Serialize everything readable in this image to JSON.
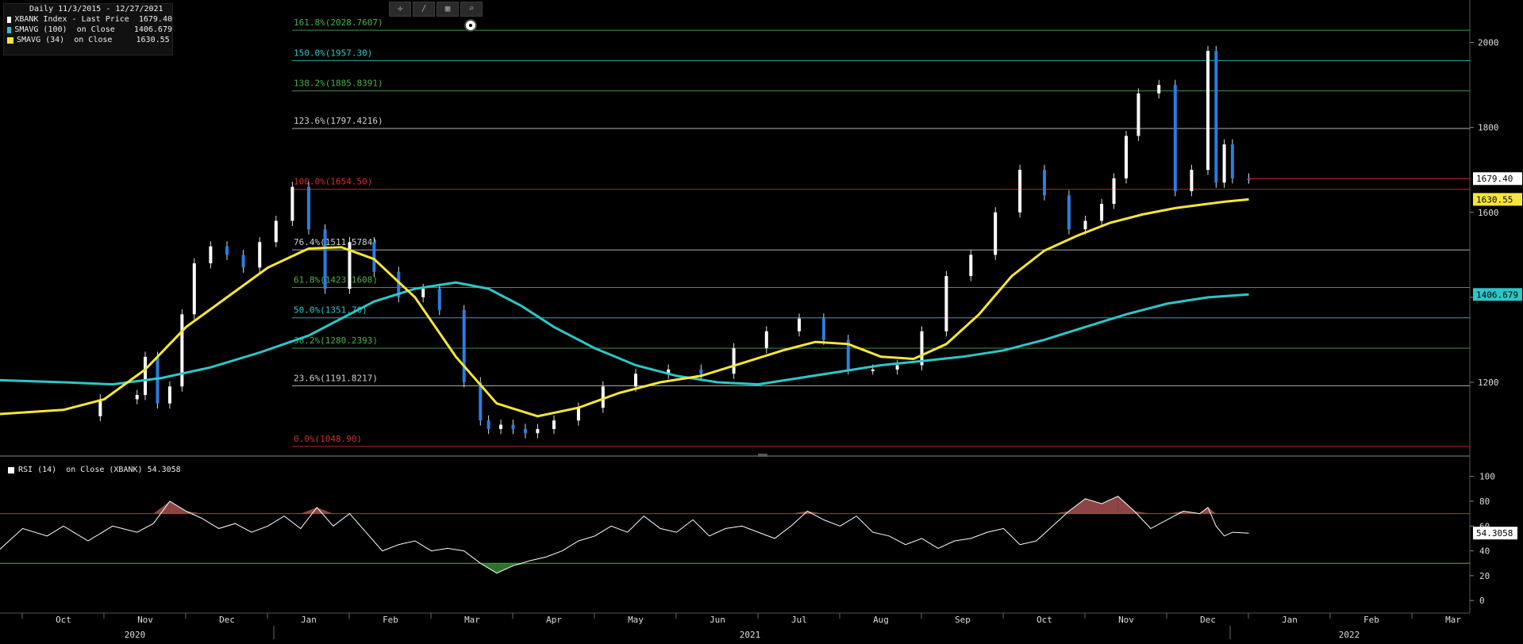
{
  "legend": {
    "date_range": "Daily 11/3/2015 - 12/27/2021",
    "rows": [
      {
        "label": "XBANK Index - Last Price  1679.40",
        "color": "#ffffff"
      },
      {
        "label": "SMAVG (100)  on Close    1406.679",
        "color": "#2fc5c8"
      },
      {
        "label": "SMAVG (34)  on Close     1630.55",
        "color": "#f5e63a"
      }
    ]
  },
  "toolbar": {
    "icons": [
      "crosshair-icon",
      "draw-line-icon",
      "chart-type-icon",
      "zoom-icon"
    ]
  },
  "rsi_legend": {
    "label": "RSI (14)  on Close (XBANK) 54.3058"
  },
  "chart_data": [
    {
      "type": "candlestick",
      "title": "XBANK Index",
      "ylim": [
        1030,
        2100
      ],
      "yticks": [
        1200,
        1400,
        1600,
        1800,
        2000
      ],
      "price_labels": [
        {
          "value": 1679.4,
          "text": "1679.40",
          "color": "#ffffff"
        },
        {
          "value": 1630.55,
          "text": "1630.55",
          "color": "#f5e63a"
        },
        {
          "value": 1406.679,
          "text": "1406.679",
          "color": "#2fc5c8"
        }
      ],
      "fib_levels": [
        {
          "label": "161.8%(2028.7607)",
          "value": 2028.7607,
          "color": "#4caf50"
        },
        {
          "label": "150.0%(1957.30)",
          "value": 1957.3,
          "color": "#2fc5c8"
        },
        {
          "label": "138.2%(1885.8391)",
          "value": 1885.8391,
          "color": "#4caf50"
        },
        {
          "label": "123.6%(1797.4216)",
          "value": 1797.4216,
          "color": "#cfcfcf"
        },
        {
          "label": "100.0%(1654.50)",
          "value": 1654.5,
          "color": "#d02f2f"
        },
        {
          "label": "76.4%(1511.5784)",
          "value": 1511.5784,
          "color": "#cfcfcf"
        },
        {
          "label": "61.8%(1423.1608)",
          "value": 1423.1608,
          "color": "#4caf50"
        },
        {
          "label": "50.0%(1351.70)",
          "value": 1351.7,
          "color": "#2fc5c8"
        },
        {
          "label": "38.2%(1280.2393)",
          "value": 1280.2393,
          "color": "#4caf50"
        },
        {
          "label": "23.6%(1191.8217)",
          "value": 1191.8217,
          "color": "#cfcfcf"
        },
        {
          "label": "0.0%(1048.90)",
          "value": 1048.9,
          "color": "#d02f2f"
        }
      ],
      "months": [
        "Oct",
        "Nov",
        "Dec",
        "Jan",
        "Feb",
        "Mar",
        "Apr",
        "May",
        "Jun",
        "Jul",
        "Aug",
        "Sep",
        "Oct",
        "Nov",
        "Dec",
        "Jan",
        "Feb",
        "Mar"
      ],
      "years": [
        "2020",
        "2021",
        "2022"
      ],
      "series": [
        {
          "name": "XBANK Index - Last Price",
          "color": "#ffffff",
          "month_index": [
            0.0,
            0.45,
            0.9,
            1.0,
            1.15,
            1.3,
            1.45,
            1.6,
            1.8,
            2.0,
            2.2,
            2.4,
            2.6,
            2.8,
            3.0,
            3.2,
            3.5,
            3.8,
            4.1,
            4.4,
            4.6,
            4.9,
            5.1,
            5.2,
            5.35,
            5.5,
            5.65,
            5.8,
            6.0,
            6.3,
            6.6,
            7.0,
            7.4,
            7.8,
            8.2,
            8.6,
            9.0,
            9.3,
            9.6,
            9.9,
            10.2,
            10.5,
            10.8,
            11.1,
            11.4,
            11.7,
            12.0,
            12.3,
            12.5,
            12.7,
            12.85,
            13.0,
            13.15,
            13.4,
            13.6,
            13.8,
            14.0,
            14.1,
            14.2,
            14.3,
            14.5
          ],
          "values": [
            1120,
            1160,
            1170,
            1260,
            1150,
            1190,
            1360,
            1480,
            1520,
            1500,
            1470,
            1530,
            1580,
            1660,
            1560,
            1420,
            1530,
            1460,
            1400,
            1420,
            1370,
            1200,
            1110,
            1090,
            1100,
            1090,
            1080,
            1090,
            1110,
            1140,
            1190,
            1220,
            1230,
            1220,
            1280,
            1320,
            1350,
            1300,
            1230,
            1230,
            1240,
            1320,
            1450,
            1500,
            1600,
            1700,
            1640,
            1560,
            1580,
            1620,
            1680,
            1780,
            1880,
            1900,
            1650,
            1700,
            1980,
            1670,
            1760,
            1680,
            1679.4
          ]
        },
        {
          "name": "SMAVG (34)",
          "color": "#f5e63a",
          "month_index": [
            -0.8,
            0.0,
            0.5,
            1.0,
            1.5,
            2.0,
            2.5,
            3.0,
            3.4,
            3.8,
            4.3,
            4.8,
            5.3,
            5.8,
            6.3,
            6.8,
            7.3,
            7.8,
            8.3,
            8.8,
            9.2,
            9.6,
            10.0,
            10.4,
            10.8,
            11.2,
            11.6,
            12.0,
            12.4,
            12.8,
            13.2,
            13.6,
            14.0,
            14.2,
            14.5
          ],
          "values": [
            1125,
            1135,
            1160,
            1230,
            1330,
            1400,
            1470,
            1515,
            1518,
            1490,
            1400,
            1260,
            1150,
            1120,
            1140,
            1175,
            1200,
            1215,
            1245,
            1275,
            1295,
            1290,
            1260,
            1255,
            1290,
            1360,
            1450,
            1510,
            1545,
            1575,
            1595,
            1610,
            1620,
            1625,
            1630.55
          ]
        },
        {
          "name": "SMAVG (100)",
          "color": "#2fc5c8",
          "month_index": [
            -0.8,
            0.0,
            0.6,
            1.2,
            1.8,
            2.4,
            3.0,
            3.4,
            3.8,
            4.3,
            4.8,
            5.2,
            5.6,
            6.0,
            6.5,
            7.0,
            7.5,
            8.0,
            8.5,
            9.0,
            9.5,
            10.0,
            10.5,
            11.0,
            11.5,
            12.0,
            12.5,
            13.0,
            13.5,
            14.0,
            14.5
          ],
          "values": [
            1205,
            1200,
            1195,
            1210,
            1235,
            1270,
            1310,
            1350,
            1390,
            1420,
            1435,
            1420,
            1380,
            1330,
            1280,
            1240,
            1215,
            1200,
            1195,
            1210,
            1225,
            1240,
            1250,
            1260,
            1275,
            1300,
            1330,
            1360,
            1385,
            1400,
            1406.679
          ]
        }
      ]
    },
    {
      "type": "line",
      "title": "RSI (14) on Close (XBANK)",
      "ylim": [
        -5,
        110
      ],
      "yticks": [
        0,
        20,
        40,
        60,
        80,
        100
      ],
      "overbought": 70,
      "oversold": 30,
      "last_value_label": "54.3058",
      "series": [
        {
          "name": "RSI (14)",
          "color": "#ffffff",
          "month_index": [
            -0.8,
            -0.5,
            -0.2,
            0.0,
            0.3,
            0.6,
            0.9,
            1.1,
            1.3,
            1.5,
            1.7,
            1.9,
            2.1,
            2.3,
            2.5,
            2.7,
            2.9,
            3.1,
            3.3,
            3.5,
            3.7,
            3.9,
            4.1,
            4.3,
            4.5,
            4.7,
            4.9,
            5.1,
            5.3,
            5.5,
            5.7,
            5.9,
            6.1,
            6.3,
            6.5,
            6.7,
            6.9,
            7.1,
            7.3,
            7.5,
            7.7,
            7.9,
            8.1,
            8.3,
            8.5,
            8.7,
            8.9,
            9.1,
            9.3,
            9.5,
            9.7,
            9.9,
            10.1,
            10.3,
            10.5,
            10.7,
            10.9,
            11.1,
            11.3,
            11.5,
            11.7,
            11.9,
            12.1,
            12.3,
            12.5,
            12.7,
            12.9,
            13.1,
            13.3,
            13.5,
            13.7,
            13.9,
            14.0,
            14.1,
            14.2,
            14.3,
            14.5
          ],
          "values": [
            40,
            58,
            52,
            60,
            48,
            60,
            55,
            62,
            80,
            72,
            66,
            58,
            62,
            55,
            60,
            68,
            58,
            75,
            60,
            70,
            55,
            40,
            45,
            48,
            40,
            42,
            40,
            30,
            22,
            28,
            32,
            35,
            40,
            48,
            52,
            60,
            55,
            68,
            58,
            55,
            65,
            52,
            58,
            60,
            55,
            50,
            60,
            72,
            65,
            60,
            68,
            55,
            52,
            45,
            50,
            42,
            48,
            50,
            55,
            58,
            45,
            48,
            60,
            72,
            82,
            78,
            84,
            72,
            58,
            65,
            72,
            70,
            75,
            60,
            52,
            55,
            54.3058
          ]
        }
      ]
    }
  ]
}
